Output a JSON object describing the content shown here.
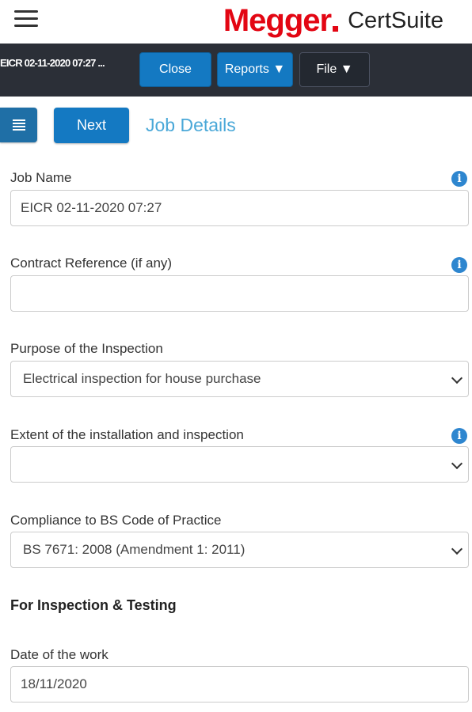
{
  "app": {
    "brand_name": "Megger",
    "brand_suite": "CertSuite",
    "brand_color": "#e30613"
  },
  "toolbar": {
    "job_title": "EICR 02-11-2020 07:27 ...",
    "close_label": "Close",
    "reports_label": "Reports ▼",
    "file_label": "File ▼"
  },
  "nav": {
    "next_label": "Next",
    "section_title": "Job Details"
  },
  "form": {
    "job_name": {
      "label": "Job Name",
      "value": "EICR 02-11-2020 07:27"
    },
    "contract_reference": {
      "label": "Contract Reference (if any)",
      "value": ""
    },
    "purpose": {
      "label": "Purpose of the Inspection",
      "selected": "Electrical inspection for house purchase"
    },
    "extent": {
      "label": "Extent of the installation and inspection",
      "selected": ""
    },
    "compliance": {
      "label": "Compliance to BS Code of Practice",
      "selected": "BS 7671: 2008 (Amendment 1: 2011)"
    },
    "inspection_heading": "For Inspection & Testing",
    "date_of_work": {
      "label": "Date of the work",
      "value": "18/11/2020"
    }
  },
  "icons": {
    "info": "i"
  },
  "colors": {
    "accent": "#1479c2",
    "toolbar_bg": "#2b2f37",
    "heading": "#4aa8d8",
    "info": "#2e86cf"
  }
}
